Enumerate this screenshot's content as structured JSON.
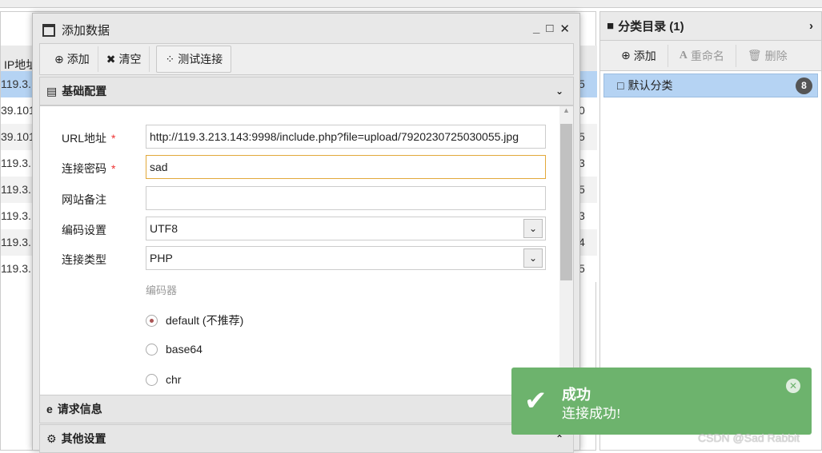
{
  "background": {
    "ip_header": "IP地址",
    "rows": [
      {
        "ip": "119.3.",
        "v": "5"
      },
      {
        "ip": "39.101",
        "v": "0"
      },
      {
        "ip": "39.101",
        "v": "5"
      },
      {
        "ip": "119.3.",
        "v": "3"
      },
      {
        "ip": "119.3.",
        "v": "5"
      },
      {
        "ip": "119.3.",
        "v": "3"
      },
      {
        "ip": "119.3.",
        "v": "4"
      },
      {
        "ip": "119.3.",
        "v": "5"
      }
    ]
  },
  "dialog": {
    "title": "添加数据",
    "toolbar": {
      "add": "添加",
      "clear": "清空",
      "test": "测试连接"
    },
    "sections": {
      "basic": "基础配置",
      "request": "请求信息",
      "other": "其他设置"
    },
    "form": {
      "url_label": "URL地址",
      "url_value": "http://119.3.213.143:9998/include.php?file=upload/7920230725030055.jpg",
      "pwd_label": "连接密码",
      "pwd_value": "sad",
      "note_label": "网站备注",
      "note_value": "",
      "enc_label": "编码设置",
      "enc_value": "UTF8",
      "type_label": "连接类型",
      "type_value": "PHP",
      "encoder_label": "编码器",
      "encoders": [
        "default (不推荐)",
        "base64",
        "chr"
      ],
      "encoder_selected": "default (不推荐)",
      "required_mark": "*"
    }
  },
  "sidebar": {
    "title": "分类目录 (1)",
    "add": "添加",
    "rename": "重命名",
    "delete": "删除",
    "categories": [
      {
        "name": "默认分类",
        "count": "8"
      }
    ]
  },
  "toast": {
    "title": "成功",
    "message": "连接成功!",
    "color": "#6db36d"
  },
  "watermark": "CSDN @Sad Rabbit"
}
